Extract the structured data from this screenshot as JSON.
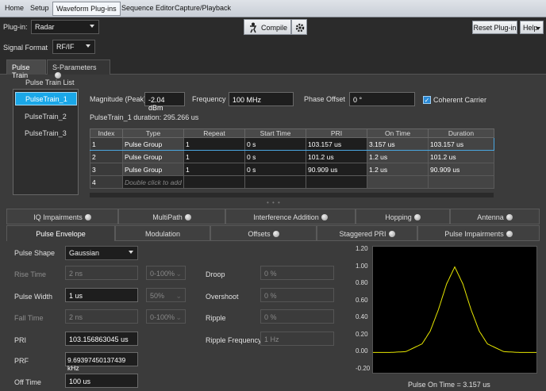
{
  "menu": {
    "items": [
      "Home",
      "Setup",
      "Waveform Plug-ins",
      "Sequence Editor",
      "Capture/Playback"
    ]
  },
  "toolbar": {
    "plugin_label": "Plug-in:",
    "plugin_value": "Radar",
    "compile_label": "Compile",
    "reset_label": "Reset Plug-in",
    "help_label": "Help"
  },
  "signal_format": {
    "label": "Signal Format",
    "value": "RF/IF"
  },
  "top_tabs": [
    "Pulse Train",
    "S-Parameters"
  ],
  "pulse_train": {
    "list_title": "Pulse Train List",
    "items": [
      "PulseTrain_1",
      "PulseTrain_2",
      "PulseTrain_3"
    ],
    "magnitude_label": "Magnitude (Peak)",
    "magnitude_value": "-2.04 dBm",
    "frequency_label": "Frequency",
    "frequency_value": "100 MHz",
    "phase_label": "Phase Offset",
    "phase_value": "0 °",
    "coherent_label": "Coherent Carrier",
    "coherent_checked": true,
    "duration_text": "PulseTrain_1 duration: 295.266 us"
  },
  "grid": {
    "headers": [
      "Index",
      "Type",
      "Repeat",
      "Start Time",
      "PRI",
      "On Time",
      "Duration"
    ],
    "rows": [
      [
        "1",
        "Pulse Group",
        "1",
        "0 s",
        "103.157 us",
        "3.157 us",
        "103.157 us"
      ],
      [
        "2",
        "Pulse Group",
        "1",
        "0 s",
        "101.2 us",
        "1.2 us",
        "101.2 us"
      ],
      [
        "3",
        "Pulse Group",
        "1",
        "0 s",
        "90.909 us",
        "1.2 us",
        "90.909 us"
      ],
      [
        "4",
        "Double click to add",
        "",
        "",
        "",
        "",
        ""
      ]
    ]
  },
  "tabs_row1": [
    "IQ Impairments",
    "MultiPath",
    "Interference Addition",
    "Hopping",
    "Antenna"
  ],
  "tabs_row2": [
    "Pulse Envelope",
    "Modulation",
    "Offsets",
    "Staggered PRI",
    "Pulse Impairments"
  ],
  "envelope": {
    "shape_label": "Pulse Shape",
    "shape_value": "Gaussian",
    "rise_label": "Rise Time",
    "rise_value": "2 ns",
    "rise_range": "0-100%",
    "width_label": "Pulse Width",
    "width_value": "1 us",
    "width_range": "50%",
    "fall_label": "Fall Time",
    "fall_value": "2 ns",
    "fall_range": "0-100%",
    "pri_label": "PRI",
    "pri_value": "103.156863045 us",
    "prf_label": "PRF",
    "prf_value": "9.69397450137439 kHz",
    "off_label": "Off Time",
    "off_value": "100 us",
    "droop_label": "Droop",
    "droop_value": "0 %",
    "overshoot_label": "Overshoot",
    "overshoot_value": "0 %",
    "ripple_label": "Ripple",
    "ripple_value": "0 %",
    "ripple_freq_label": "Ripple Frequency",
    "ripple_freq_value": "1 Hz"
  },
  "chart_data": {
    "type": "line",
    "title": "",
    "xlabel": "Pulse On Time = 3.157 us",
    "ylabel": "",
    "ylim": [
      -0.2,
      1.2
    ],
    "y_ticks": [
      "1.20",
      "1.00",
      "0.80",
      "0.60",
      "0.40",
      "0.20",
      "0.00",
      "-0.20"
    ],
    "series": [
      {
        "color": "#e6e600",
        "x": [
          0,
          0.1,
          0.2,
          0.3,
          0.35,
          0.4,
          0.45,
          0.5,
          0.55,
          0.6,
          0.65,
          0.7,
          0.8,
          0.9,
          1.0
        ],
        "y": [
          0.0,
          0.0,
          0.01,
          0.1,
          0.25,
          0.5,
          0.8,
          1.0,
          0.8,
          0.5,
          0.25,
          0.1,
          0.01,
          0.0,
          0.0
        ]
      }
    ]
  }
}
